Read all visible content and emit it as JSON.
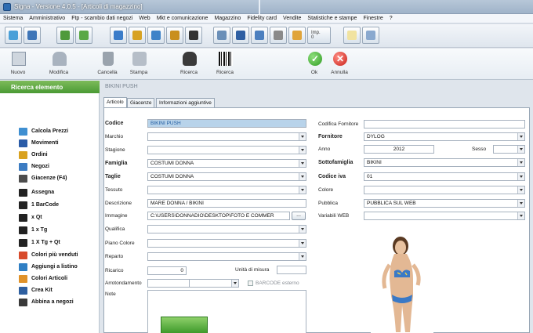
{
  "window": {
    "title": "Signa - Versione 4.0.5 - [Articoli di magazzino]"
  },
  "menu": [
    "Sistema",
    "Amministrativo",
    "Ftp - scambio dati negozi",
    "Web",
    "Mkt e comunicazione",
    "Magazzino",
    "Fidelity card",
    "Vendite",
    "Statistiche e stampe",
    "Finestre",
    "?"
  ],
  "toolbar1": {
    "imp_label": "Imp. 0"
  },
  "toolbar2": {
    "nuovo": "Nuovo",
    "modifica": "Modifica",
    "cancella": "Cancella",
    "stampa": "Stampa",
    "ricerca1": "Ricerca",
    "ricerca2": "Ricerca",
    "ok": "Ok",
    "annulla": "Annulla"
  },
  "sidebar": {
    "header": "Ricerca elemento",
    "items": [
      {
        "label": "Calcola Prezzi",
        "icon": "calculator-icon",
        "color": "#3f8fd1"
      },
      {
        "label": "Movimenti",
        "icon": "arrows-icon",
        "color": "#2a5ca8"
      },
      {
        "label": "Ordini",
        "icon": "box-icon",
        "color": "#d9a21f"
      },
      {
        "label": "Negozi",
        "icon": "shop-icon",
        "color": "#3c7cc2"
      },
      {
        "label": "Giacenze (F4)",
        "icon": "stock-icon",
        "color": "#4d4d4d"
      },
      {
        "label": "Assegna",
        "icon": "barcode-icon",
        "color": "#222222"
      },
      {
        "label": "1 BarCode",
        "icon": "barcode-icon",
        "color": "#222222"
      },
      {
        "label": "x Qt",
        "icon": "barcode-icon",
        "color": "#222222"
      },
      {
        "label": "1 x Tg",
        "icon": "barcode-icon",
        "color": "#222222"
      },
      {
        "label": "1 X Tg + Qt",
        "icon": "barcode-icon",
        "color": "#222222"
      },
      {
        "label": "Colori più venduti",
        "icon": "palette-icon",
        "color": "#d84a2b"
      },
      {
        "label": "Aggiungi a listino",
        "icon": "add-list-icon",
        "color": "#2f7fc4"
      },
      {
        "label": "Colori Articoli",
        "icon": "palette-icon",
        "color": "#e0922a"
      },
      {
        "label": "Crea Kit",
        "icon": "kit-icon",
        "color": "#2e5fa0"
      },
      {
        "label": "Abbina a negozi",
        "icon": "link-icon",
        "color": "#3a3a3a"
      }
    ]
  },
  "main": {
    "record_title": "BIKINI PUSH",
    "tabs": [
      "Articolo",
      "Giacenze",
      "Informazioni aggiuntive"
    ]
  },
  "form": {
    "codice": {
      "label": "Codice",
      "value": "BIKINI PUSH"
    },
    "marchio": {
      "label": "Marchio",
      "value": ""
    },
    "stagione": {
      "label": "Stagione",
      "value": ""
    },
    "famiglia": {
      "label": "Famiglia",
      "value": "COSTUMI DONNA"
    },
    "taglie": {
      "label": "Taglie",
      "value": "COSTUMI DONNA"
    },
    "tessuto": {
      "label": "Tessuto",
      "value": ""
    },
    "descrizione": {
      "label": "Descrizione",
      "value": "MARE DONNA / BIKINI"
    },
    "immagine": {
      "label": "Immagine",
      "value": "C:\\USERS\\DONNADIO\\DESKTOP\\FOTO E COMMER",
      "browse": "..."
    },
    "qualifica": {
      "label": "Qualifica",
      "value": ""
    },
    "piano_colore": {
      "label": "Piano Colore",
      "value": ""
    },
    "reparto": {
      "label": "Reparto",
      "value": ""
    },
    "ricarico": {
      "label": "Ricarico",
      "value": "0"
    },
    "unita_misura": {
      "label": "Unità di misura",
      "value": ""
    },
    "arrotondamento": {
      "label": "Arrotondamento",
      "value": ""
    },
    "barcode_esterno": {
      "label": "BARCODE esterno"
    },
    "note": {
      "label": "Note"
    },
    "codifica_fornitore": {
      "label": "Codifica Fornitore",
      "value": ""
    },
    "fornitore": {
      "label": "Fornitore",
      "value": "DYLOG"
    },
    "anno": {
      "label": "Anno",
      "value": "2012"
    },
    "sesso": {
      "label": "Sesso",
      "value": ""
    },
    "sottofamiglia": {
      "label": "Sottofamiglia",
      "value": "BIKINI"
    },
    "codice_iva": {
      "label": "Codice iva",
      "value": "01"
    },
    "colore": {
      "label": "Colore",
      "value": ""
    },
    "pubblica": {
      "label": "Pubblica",
      "value": "PUBBLICA SUL WEB"
    },
    "variabili_web": {
      "label": "Variabili WEB",
      "value": ""
    }
  },
  "colors": {
    "accent_green": "#4a9a34",
    "highlight": "#b8d3ea",
    "bikini_blue": "#3a79c6"
  }
}
